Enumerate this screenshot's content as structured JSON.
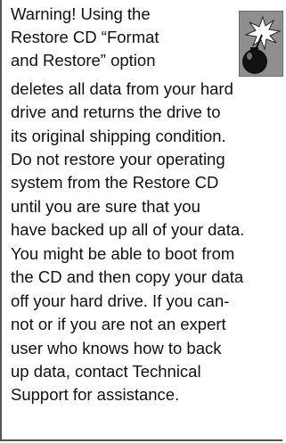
{
  "warning": {
    "lines": [
      "Warning! Using the",
      "Restore CD “Format",
      "and Restore” option",
      "deletes all data from your hard",
      "drive and returns the drive to",
      "its original shipping condition.",
      "Do not restore your operating",
      "system from the Restore CD",
      "until you are sure that you",
      "have backed up all of your data.",
      "You might be able to boot from",
      "the CD and then copy your data",
      "off your hard drive. If you can-",
      "not or if you are not an expert",
      "user who knows how to back",
      "up data, contact Technical",
      "Support for assistance."
    ],
    "icon": "bomb-icon"
  }
}
